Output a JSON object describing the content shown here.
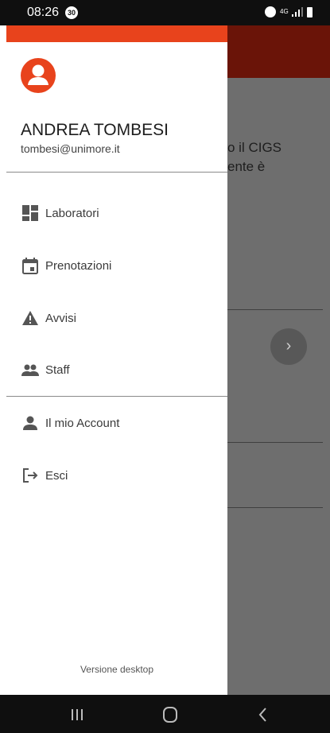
{
  "status_bar": {
    "time": "08:26",
    "notification_count": "30",
    "network_label": "4G"
  },
  "background": {
    "text_line_1": "o il CIGS",
    "text_line_2": "ente è"
  },
  "drawer": {
    "accent_color": "#e8431c",
    "user": {
      "name": "ANDREA TOMBESI",
      "email": "tombesi@unimore.it"
    },
    "nav_items": [
      {
        "label": "Laboratori",
        "icon": "dashboard-icon"
      },
      {
        "label": "Prenotazioni",
        "icon": "calendar-icon"
      },
      {
        "label": "Avvisi",
        "icon": "warning-icon"
      },
      {
        "label": "Staff",
        "icon": "people-icon"
      }
    ],
    "account_items": [
      {
        "label": "Il mio Account",
        "icon": "person-icon"
      },
      {
        "label": "Esci",
        "icon": "logout-icon"
      }
    ],
    "desktop_link": "Versione desktop"
  }
}
